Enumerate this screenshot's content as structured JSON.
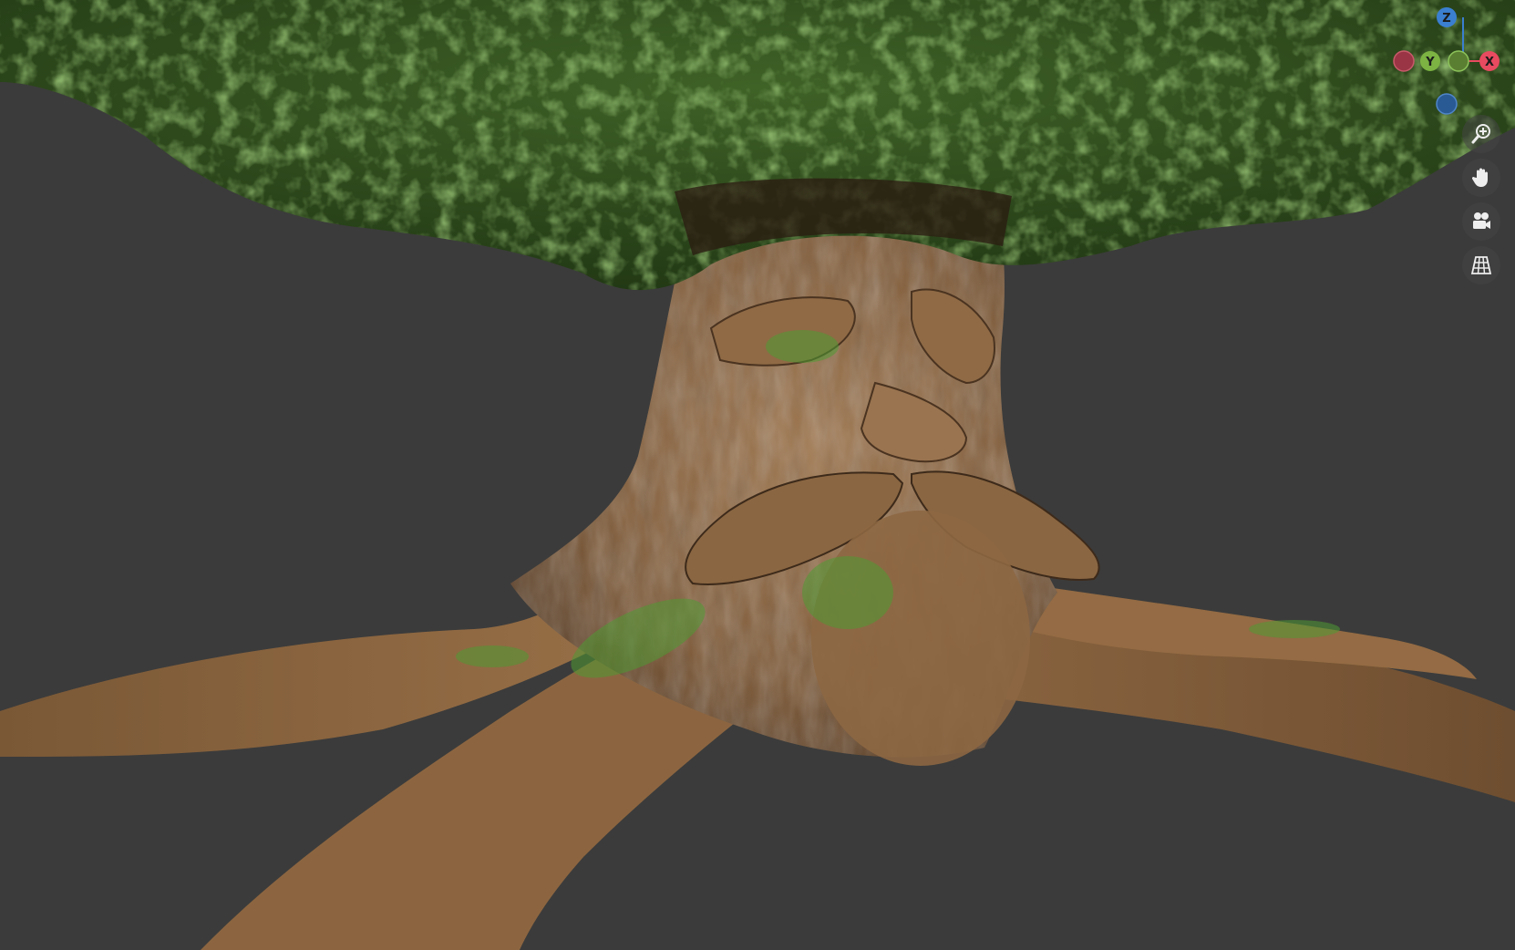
{
  "viewport": {
    "background_color": "#3b3b3b"
  },
  "gizmo": {
    "z_label": "Z",
    "y_label": "Y",
    "x_label": "X",
    "x_color": "#e84a5f",
    "y_color": "#7cb342",
    "z_color": "#3a7fd0",
    "neg_x_color": "#9a3545",
    "neg_y_color": "#5b7f32",
    "neg_z_color": "#2a5a94"
  },
  "navigation": {
    "icons": [
      "zoom-icon",
      "hand-pan-icon",
      "camera-icon",
      "grid-icon"
    ]
  },
  "scene": {
    "foliage_color": "#2f4a1e",
    "leaf_highlight_color": "#6c9a3a",
    "bark_color": "#8a6440",
    "bark_shadow_color": "#4a3320",
    "moss_color": "#4f9a33"
  }
}
